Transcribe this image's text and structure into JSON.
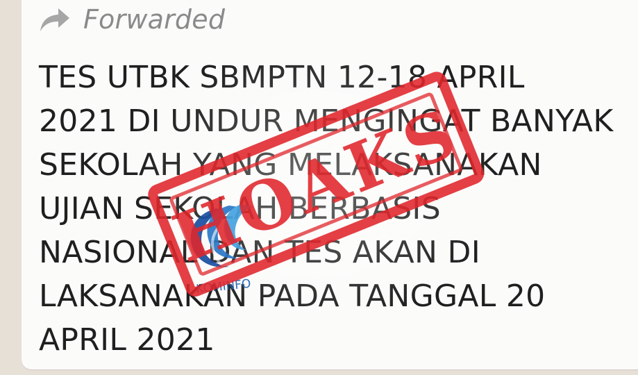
{
  "forwarded": {
    "label": "Forwarded",
    "icon": "forward-arrow-icon"
  },
  "message": {
    "lines": [
      "TES UTBK SBMPTN 12-18 APRIL",
      "2021 DI UNDUR MENGINGAT BANYAK",
      "SEKOLAH YANG MELAKSANAKAN",
      "UJIAN SEKOLAH BERBASIS",
      "NASIONAL DAN TES AKAN DI",
      "LAKSANAKAN PADA TANGGAL 20",
      "APRIL 2021"
    ]
  },
  "stamp": {
    "text": "HOAKS",
    "color": "#e0262b"
  },
  "logo": {
    "text": "KOMINFO",
    "color": "#1d5fb3"
  },
  "colors": {
    "background": "#e7e0d7",
    "bubble": "#fbfbfa",
    "text": "#1f1f1f",
    "forwarded": "#8a8a8a"
  }
}
